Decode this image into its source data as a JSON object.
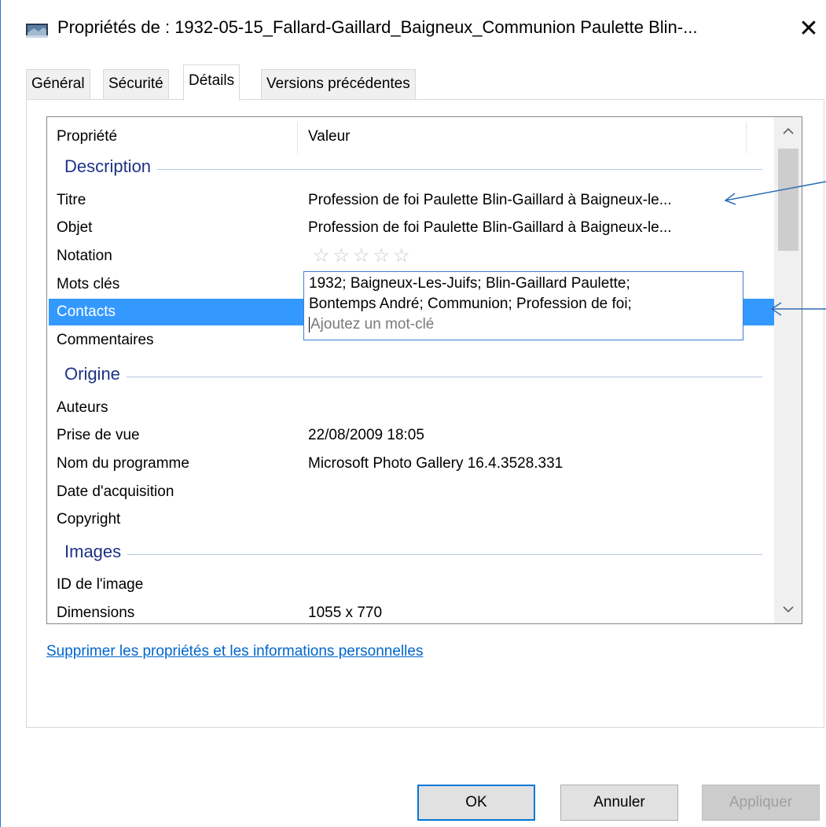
{
  "window": {
    "title": "Propriétés de : 1932-05-15_Fallard-Gaillard_Baigneux_Communion Paulette Blin-...",
    "close_glyph": "✕"
  },
  "tabs": [
    {
      "label": "Général"
    },
    {
      "label": "Sécurité"
    },
    {
      "label": "Détails"
    },
    {
      "label": "Versions précédentes"
    }
  ],
  "columns": {
    "property": "Propriété",
    "value": "Valeur"
  },
  "groups": {
    "description": "Description",
    "origin": "Origine",
    "images": "Images"
  },
  "rows": {
    "title": {
      "name": "Titre",
      "value": "Profession de foi Paulette Blin-Gaillard à Baigneux-le..."
    },
    "subject": {
      "name": "Objet",
      "value": "Profession de foi Paulette Blin-Gaillard à Baigneux-le..."
    },
    "rating": {
      "name": "Notation",
      "value": "☆☆☆☆☆"
    },
    "keywords": {
      "name": "Mots clés"
    },
    "contacts": {
      "name": "Contacts"
    },
    "comments": {
      "name": "Commentaires"
    },
    "authors": {
      "name": "Auteurs"
    },
    "date_taken": {
      "name": "Prise de vue",
      "value": "22/08/2009 18:05"
    },
    "program": {
      "name": "Nom du programme",
      "value": "Microsoft Photo Gallery 16.4.3528.331"
    },
    "acquired": {
      "name": "Date d'acquisition"
    },
    "copyright": {
      "name": "Copyright"
    },
    "image_id": {
      "name": "ID de l'image"
    },
    "dimensions": {
      "name": "Dimensions",
      "value": "1055 x 770"
    }
  },
  "keyword_editor": {
    "line1": "1932; Baigneux-Les-Juifs; Blin-Gaillard Paulette;",
    "line2": "Bontemps André; Communion; Profession de foi;",
    "placeholder": "Ajoutez un mot-clé"
  },
  "scrollbar": {
    "up_glyph": "⌃",
    "down_glyph": "⌄"
  },
  "link_label": "Supprimer les propriétés et les informations personnelles",
  "buttons": {
    "ok": "OK",
    "cancel": "Annuler",
    "apply": "Appliquer"
  },
  "colors": {
    "selection": "#3399ff",
    "group_text": "#1e3287",
    "link": "#0066cc",
    "annotation_arrow": "#2e6db4"
  },
  "icons": {
    "window": "photo-file-icon",
    "close": "close-icon",
    "star": "star-icon"
  }
}
